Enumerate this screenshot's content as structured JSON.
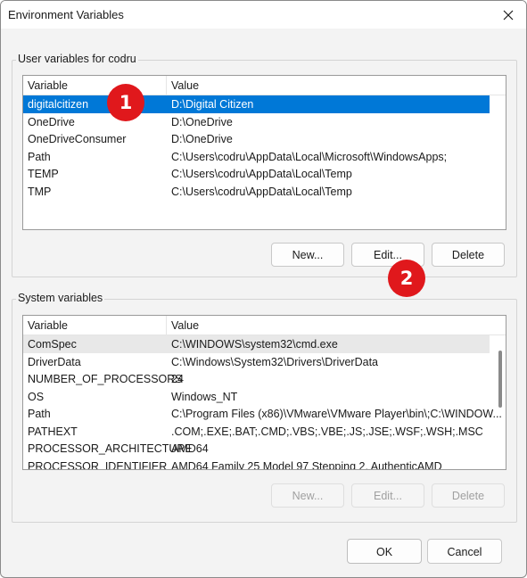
{
  "window": {
    "title": "Environment Variables"
  },
  "user_section": {
    "legend": "User variables for codru",
    "columns": [
      "Variable",
      "Value"
    ],
    "rows": [
      {
        "variable": "digitalcitizen",
        "value": "D:\\Digital Citizen"
      },
      {
        "variable": "OneDrive",
        "value": "D:\\OneDrive"
      },
      {
        "variable": "OneDriveConsumer",
        "value": "D:\\OneDrive"
      },
      {
        "variable": "Path",
        "value": "C:\\Users\\codru\\AppData\\Local\\Microsoft\\WindowsApps;"
      },
      {
        "variable": "TEMP",
        "value": "C:\\Users\\codru\\AppData\\Local\\Temp"
      },
      {
        "variable": "TMP",
        "value": "C:\\Users\\codru\\AppData\\Local\\Temp"
      }
    ],
    "buttons": {
      "new": "New...",
      "edit": "Edit...",
      "delete": "Delete"
    }
  },
  "system_section": {
    "legend": "System variables",
    "columns": [
      "Variable",
      "Value"
    ],
    "rows": [
      {
        "variable": "ComSpec",
        "value": "C:\\WINDOWS\\system32\\cmd.exe"
      },
      {
        "variable": "DriverData",
        "value": "C:\\Windows\\System32\\Drivers\\DriverData"
      },
      {
        "variable": "NUMBER_OF_PROCESSORS",
        "value": "24"
      },
      {
        "variable": "OS",
        "value": "Windows_NT"
      },
      {
        "variable": "Path",
        "value": "C:\\Program Files (x86)\\VMware\\VMware Player\\bin\\;C:\\WINDOW..."
      },
      {
        "variable": "PATHEXT",
        "value": ".COM;.EXE;.BAT;.CMD;.VBS;.VBE;.JS;.JSE;.WSF;.WSH;.MSC"
      },
      {
        "variable": "PROCESSOR_ARCHITECTURE",
        "value": "AMD64"
      },
      {
        "variable": "PROCESSOR_IDENTIFIER",
        "value": "AMD64 Family 25 Model 97 Stepping 2, AuthenticAMD"
      }
    ],
    "buttons": {
      "new": "New...",
      "edit": "Edit...",
      "delete": "Delete"
    }
  },
  "footer": {
    "ok": "OK",
    "cancel": "Cancel"
  },
  "annotations": {
    "step1": "1",
    "step2": "2"
  },
  "colors": {
    "selection": "#0078d7",
    "badge": "#e0181c"
  },
  "icons": {
    "close": "close-icon"
  }
}
